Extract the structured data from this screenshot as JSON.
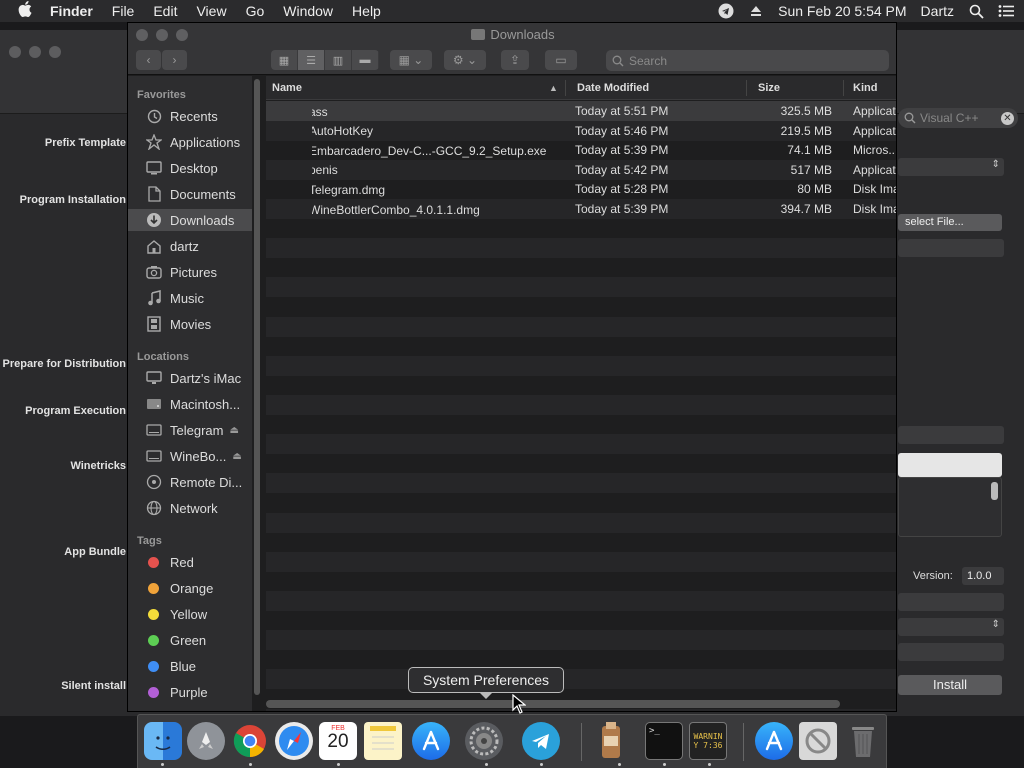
{
  "menubar": {
    "app": "Finder",
    "items": [
      "File",
      "Edit",
      "View",
      "Go",
      "Window",
      "Help"
    ],
    "datetime": "Sun Feb 20  5:54 PM",
    "user": "Dartz"
  },
  "background_window": {
    "search_placeholder": "Visual C++",
    "labels": [
      "Prefix Template",
      "Program Installation",
      "Prepare for Distribution",
      "Program Execution",
      "Winetricks",
      "App Bundle",
      "Silent install"
    ],
    "select_file": "select File...",
    "version_label": "Version:",
    "version_value": "1.0.0",
    "install_button": "Install"
  },
  "finder": {
    "title": "Downloads",
    "search_placeholder": "Search",
    "sidebar": {
      "favorites_header": "Favorites",
      "favorites": [
        {
          "label": "Recents",
          "icon": "clock-icon"
        },
        {
          "label": "Applications",
          "icon": "applications-icon"
        },
        {
          "label": "Desktop",
          "icon": "desktop-icon"
        },
        {
          "label": "Documents",
          "icon": "document-icon"
        },
        {
          "label": "Downloads",
          "icon": "download-icon"
        },
        {
          "label": "dartz",
          "icon": "home-icon"
        },
        {
          "label": "Pictures",
          "icon": "camera-icon"
        },
        {
          "label": "Music",
          "icon": "music-icon"
        },
        {
          "label": "Movies",
          "icon": "film-icon"
        }
      ],
      "locations_header": "Locations",
      "locations": [
        {
          "label": "Dartz's iMac",
          "icon": "imac-icon"
        },
        {
          "label": "Macintosh...",
          "icon": "disk-icon"
        },
        {
          "label": "Telegram",
          "icon": "drive-icon"
        },
        {
          "label": "WineBo...",
          "icon": "drive-icon"
        },
        {
          "label": "Remote Di...",
          "icon": "disc-icon"
        },
        {
          "label": "Network",
          "icon": "network-icon"
        }
      ],
      "tags_header": "Tags",
      "tags": [
        {
          "label": "Red",
          "color": "#e5524e"
        },
        {
          "label": "Orange",
          "color": "#f0a33a"
        },
        {
          "label": "Yellow",
          "color": "#f3dc3a"
        },
        {
          "label": "Green",
          "color": "#5dce54"
        },
        {
          "label": "Blue",
          "color": "#3f8ef5"
        },
        {
          "label": "Purple",
          "color": "#b25fd6"
        }
      ]
    },
    "columns": {
      "name": "Name",
      "date": "Date Modified",
      "size": "Size",
      "kind": "Kind"
    },
    "files": [
      {
        "name": "ass",
        "date": "Today at 5:51 PM",
        "size": "325.5 MB",
        "kind": "Applicat",
        "icon": "app-icon"
      },
      {
        "name": "AutoHotKey",
        "date": "Today at 5:46 PM",
        "size": "219.5 MB",
        "kind": "Applicat",
        "icon": "app-icon"
      },
      {
        "name": "Embarcadero_Dev-C...-GCC_9.2_Setup.exe",
        "date": "Today at 5:39 PM",
        "size": "74.1 MB",
        "kind": "Micros...",
        "icon": "file-icon"
      },
      {
        "name": "penis",
        "date": "Today at 5:42 PM",
        "size": "517 MB",
        "kind": "Applicat",
        "icon": "devcpp-icon"
      },
      {
        "name": "Telegram.dmg",
        "date": "Today at 5:28 PM",
        "size": "80 MB",
        "kind": "Disk Ima",
        "icon": "dmg-icon"
      },
      {
        "name": "WineBottlerCombo_4.0.1.1.dmg",
        "date": "Today at 5:39 PM",
        "size": "394.7 MB",
        "kind": "Disk Ima",
        "icon": "dmg-icon"
      }
    ]
  },
  "tooltip": "System Preferences",
  "dock": {
    "calendar_month": "FEB",
    "calendar_day": "20",
    "console_text": "WARNIN",
    "console_text2": "Y 7:36",
    "terminal_prompt": ">_",
    "apps": [
      "finder-icon",
      "launchpad-icon",
      "chrome-icon",
      "safari-icon",
      "calendar-icon",
      "notes-icon",
      "app-store-icon",
      "system-preferences-icon",
      "telegram-icon",
      "winebottler-icon",
      "terminal-icon",
      "console-icon",
      "app-store-download-icon",
      "disabled-app-icon",
      "trash-icon"
    ]
  }
}
